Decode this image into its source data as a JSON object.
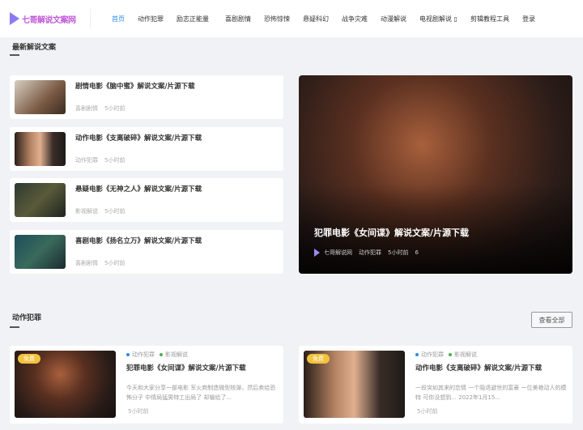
{
  "header": {
    "logo_text": "七哥解说文案网",
    "nav": [
      "首页",
      "动作犯罪",
      "励志正能量",
      "喜剧剧情",
      "恐怖惊悚",
      "悬疑科幻",
      "战争灾难",
      "动漫解说",
      "电视剧解说 ▯",
      "剪辑教程工具",
      "登录"
    ]
  },
  "latest": {
    "title": "最新解说文案",
    "items": [
      {
        "title": "剧情电影《脑中蜜》解说文案/片源下载",
        "category": "喜剧剧情",
        "time": "5小时前"
      },
      {
        "title": "动作电影《支离破碎》解说文案/片源下载",
        "category": "动作犯罪",
        "time": "5小时前"
      },
      {
        "title": "悬疑电影《无神之人》解说文案/片源下载",
        "category": "影视解说",
        "time": "5小时前"
      },
      {
        "title": "喜剧电影《扬名立万》解说文案/片源下载",
        "category": "喜剧剧情",
        "time": "5小时前"
      }
    ],
    "featured": {
      "title": "犯罪电影《女间谍》解说文案/片源下载",
      "author": "七哥解说网",
      "category": "动作犯罪",
      "time": "5小时前",
      "views": "6"
    }
  },
  "action": {
    "title": "动作犯罪",
    "view_all": "查看全部",
    "posts": [
      {
        "badge": "免费",
        "tags": [
          "动作犯罪",
          "影视解说"
        ],
        "title": "犯罪电影《女间谍》解说文案/片源下载",
        "excerpt": "今天和大家分享一部电影 军火商制造微型核弹，然后卖给恐怖分子 中情局猛男特工出局了 却输给了...",
        "time": "5小时前"
      },
      {
        "badge": "免费",
        "tags": [
          "动作犯罪",
          "影视解说"
        ],
        "title": "动作电影《支离破碎》解说文案/片源下载",
        "excerpt": "一段突如其来的恋情 一个隐退避世的富豪 一位美艳动人的模特 可你没想到... 2022年1月15...",
        "time": "5小时前"
      }
    ]
  },
  "colors": {
    "accent": "#2c8ae6",
    "badge": "#f3c23e",
    "tag_dot_1": "#2c8ae6",
    "tag_dot_2": "#4caf50"
  }
}
